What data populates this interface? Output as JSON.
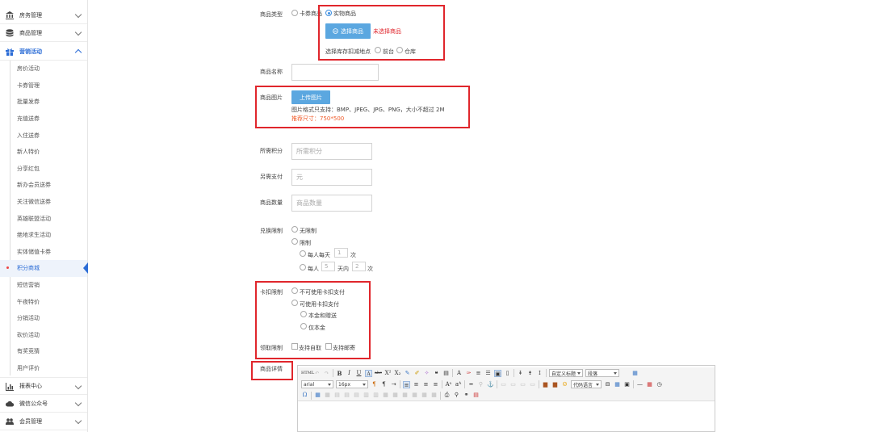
{
  "sidebar": {
    "groups_top": [
      {
        "label": "房务管理",
        "icon": "bank-icon"
      },
      {
        "label": "商品管理",
        "icon": "database-icon"
      },
      {
        "label": "营销活动",
        "icon": "gift-icon"
      }
    ],
    "sub_items": [
      "房价活动",
      "卡券管理",
      "批量发券",
      "充值送券",
      "入住送券",
      "新人特价",
      "分享红包",
      "新办会员送券",
      "关注微信送券",
      "英雄联盟活动",
      "绝地求生活动",
      "实体储值卡券",
      "积分商城",
      "短信营销",
      "午夜特价",
      "分销活动",
      "砍价活动",
      "有奖竞猜",
      "用户评价"
    ],
    "current_sub": "积分商城",
    "groups_bottom": [
      {
        "label": "报表中心",
        "icon": "bar-chart-icon"
      },
      {
        "label": "微信公众号",
        "icon": "cloud-icon"
      },
      {
        "label": "会员管理",
        "icon": "users-icon"
      }
    ]
  },
  "form": {
    "type": {
      "label": "商品类型",
      "opt_coupon": "卡券商品",
      "opt_physical": "实物商品",
      "select_btn": "选择商品",
      "not_selected": "未选择商品",
      "stock_label": "选择库存扣减地点",
      "opt_front": "前台",
      "opt_warehouse": "仓库"
    },
    "name": {
      "label": "商品名称",
      "value": ""
    },
    "image": {
      "label": "商品图片",
      "upload_btn": "上传图片",
      "hint": "图片格式只支持：BMP、JPEG、JPG、PNG，大小不超过 2M",
      "recommend": "推荐尺寸：750*500"
    },
    "points": {
      "label": "所需积分",
      "placeholder": "所需积分"
    },
    "extra_pay": {
      "label": "另需支付",
      "placeholder": "元"
    },
    "quantity": {
      "label": "商品数量",
      "placeholder": "商品数量"
    },
    "limit": {
      "label": "兑换限制",
      "opt_none": "无限制",
      "opt_limit": "限制",
      "per_day_prefix": "每人每天",
      "per_day_value": "1",
      "times": "次",
      "per_person": "每人",
      "days_value": "5",
      "days_within": "天内",
      "count_value": "2"
    },
    "card": {
      "label": "卡扣限制",
      "opt_no": "不可使用卡扣支付",
      "opt_yes": "可使用卡扣支付",
      "opt_principal_gift": "本金和赠送",
      "opt_principal_only": "仅本金"
    },
    "pickup": {
      "label": "领取限制",
      "opt_self": "支持自取",
      "opt_mail": "支持邮寄"
    },
    "detail": {
      "label": "商品详情",
      "editor": {
        "font_family": "arial",
        "font_size": "16px",
        "custom_title": "自定义标题",
        "paragraph": "段落",
        "code_lang": "代码语言"
      }
    }
  },
  "colors": {
    "accent": "#2b6cd6",
    "button": "#5ba7e0",
    "highlight": "#e0262c",
    "warning": "#f05a28"
  }
}
